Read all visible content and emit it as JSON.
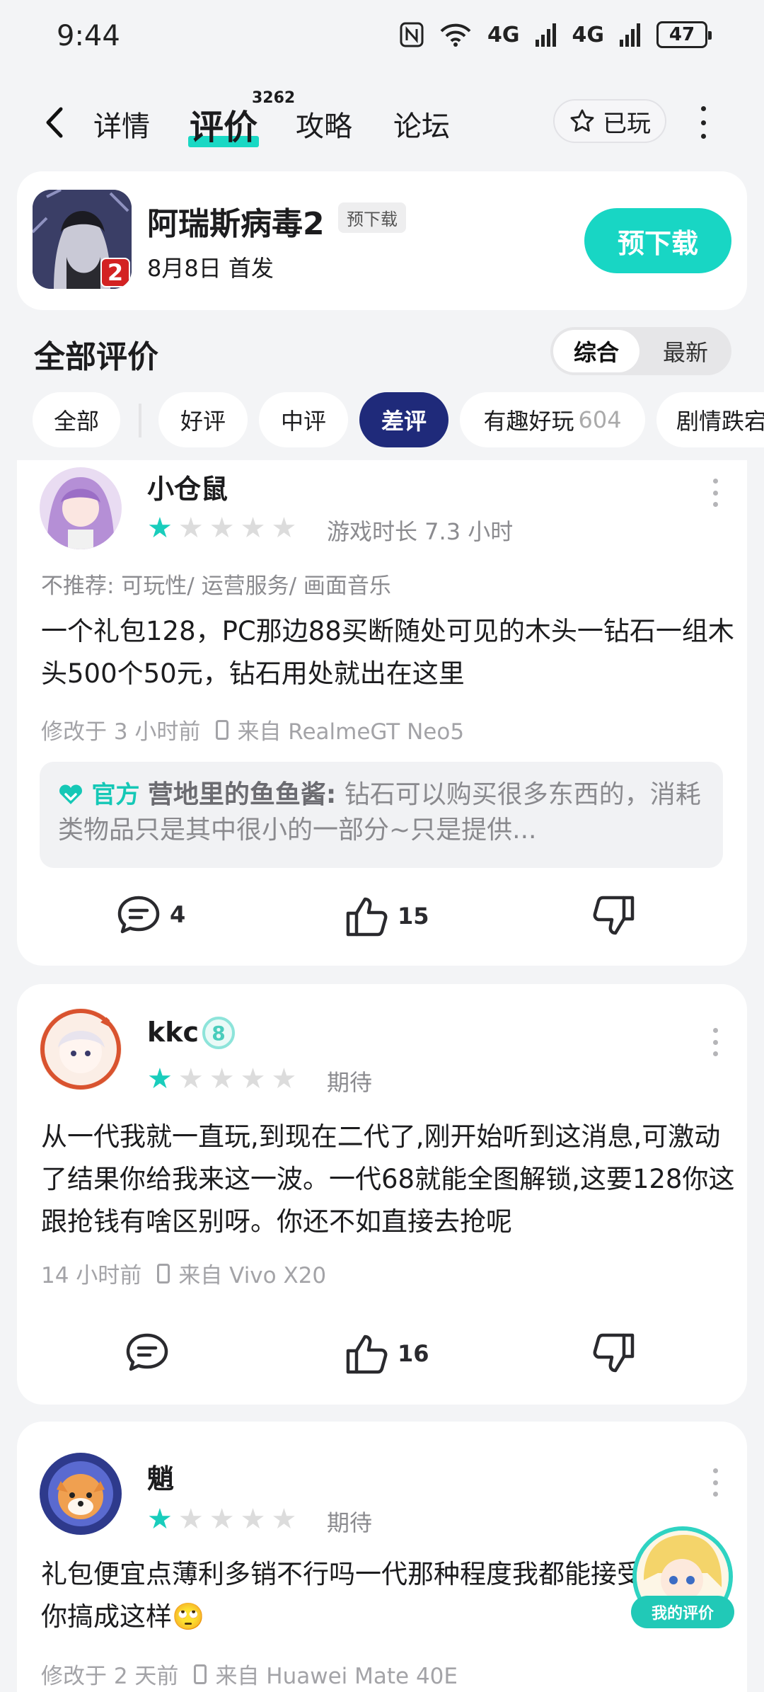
{
  "status_bar": {
    "time": "9:44",
    "icons": [
      "nfc-icon",
      "wifi-icon",
      "signal-icon",
      "signal-icon"
    ],
    "network_a": "4G",
    "network_b": "4G",
    "battery": "47"
  },
  "nav": {
    "tabs": [
      {
        "label": "详情"
      },
      {
        "label": "评价",
        "count": "3262",
        "active": true
      },
      {
        "label": "攻略"
      },
      {
        "label": "论坛"
      }
    ],
    "played_label": "已玩"
  },
  "game": {
    "title": "阿瑞斯病毒2",
    "tag": "预下载",
    "badge": "2",
    "release": "8月8日 首发",
    "action_label": "预下载"
  },
  "reviews_header": {
    "title": "全部评价",
    "sort_options": [
      "综合",
      "最新"
    ],
    "sort_active": "综合"
  },
  "filters": [
    {
      "label": "全部"
    },
    {
      "label": "好评"
    },
    {
      "label": "中评"
    },
    {
      "label": "差评",
      "active": true
    },
    {
      "label": "有趣好玩",
      "count": "604"
    },
    {
      "label": "剧情跌宕"
    }
  ],
  "reviews": [
    {
      "user": "小仓鼠",
      "rating": 1,
      "play_info": "游戏时长 7.3 小时",
      "tags": "不推荐: 可玩性/ 运营服务/ 画面音乐",
      "content": "一个礼包128，PC那边88买断随处可见的木头一钻石一组木头500个50元，钻石用处就出在这里",
      "time": "修改于 3 小时前",
      "device": "来自 RealmeGT Neo5",
      "official_reply": {
        "label": "官方",
        "name": "营地里的鱼鱼酱",
        "text": "钻石可以购买很多东西的，消耗类物品只是其中很小的一部分~只是提供..."
      },
      "comments": "4",
      "likes": "15"
    },
    {
      "user": "kkc",
      "level": "8",
      "rating": 1,
      "play_info": "期待",
      "content": "从一代我就一直玩,到现在二代了,刚开始听到这消息,可激动了结果你给我来这一波。一代68就能全图解锁,这要128你这跟抢钱有啥区别呀。你还不如直接去抢呢",
      "time": "14 小时前",
      "device": "来自 Vivo X20",
      "comments": "",
      "likes": "16"
    },
    {
      "user": "魈",
      "rating": 1,
      "play_info": "期待",
      "content": "礼包便宜点薄利多销不行吗一代那种程度我都能接受，二代你搞成这样🙄",
      "time": "修改于 2 天前",
      "device": "来自 Huawei Mate 40E"
    }
  ],
  "fab": {
    "label": "我的评价"
  },
  "colors": {
    "accent": "#18d6c4",
    "chip_active": "#1f2a7a",
    "star_on": "#19cdbc"
  }
}
